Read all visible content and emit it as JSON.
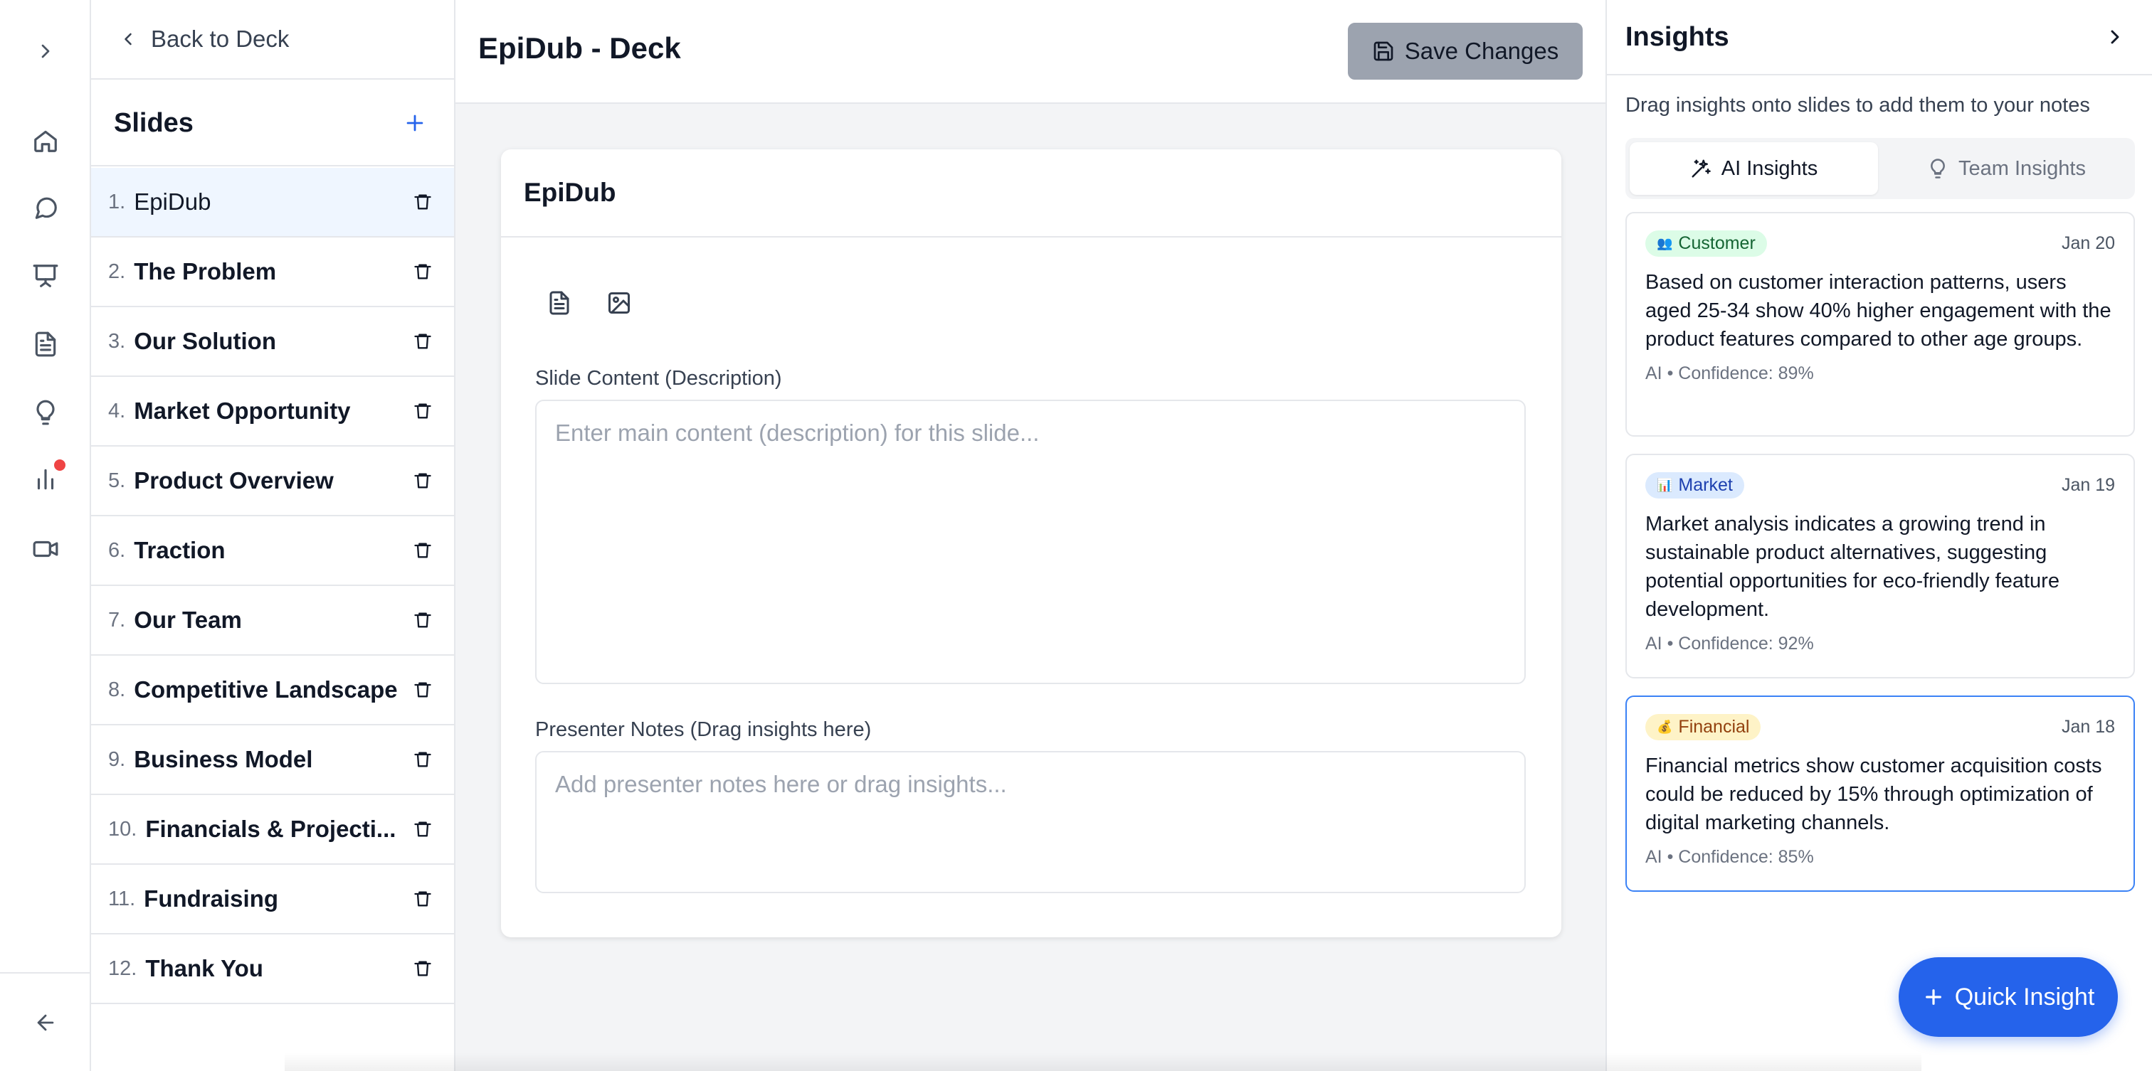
{
  "nav": {
    "items": [
      {
        "name": "expand",
        "icon": "chevron-right-icon"
      },
      {
        "name": "home",
        "icon": "home-icon"
      },
      {
        "name": "chat",
        "icon": "chat-icon"
      },
      {
        "name": "presentation",
        "icon": "presentation-icon"
      },
      {
        "name": "documents",
        "icon": "document-icon"
      },
      {
        "name": "ideas",
        "icon": "lightbulb-icon"
      },
      {
        "name": "analytics",
        "icon": "bar-chart-icon",
        "notification": true
      },
      {
        "name": "video",
        "icon": "video-icon"
      },
      {
        "name": "back",
        "icon": "arrow-left-icon"
      }
    ]
  },
  "sidebar": {
    "back_label": "Back to Deck",
    "title": "Slides",
    "slides": [
      {
        "num": "1.",
        "title": "EpiDub",
        "active": true
      },
      {
        "num": "2.",
        "title": "The Problem"
      },
      {
        "num": "3.",
        "title": "Our Solution"
      },
      {
        "num": "4.",
        "title": "Market Opportunity"
      },
      {
        "num": "5.",
        "title": "Product Overview"
      },
      {
        "num": "6.",
        "title": "Traction"
      },
      {
        "num": "7.",
        "title": "Our Team"
      },
      {
        "num": "8.",
        "title": "Competitive Landscape"
      },
      {
        "num": "9.",
        "title": "Business Model"
      },
      {
        "num": "10.",
        "title": "Financials & Projecti..."
      },
      {
        "num": "11.",
        "title": "Fundraising"
      },
      {
        "num": "12.",
        "title": "Thank You"
      }
    ]
  },
  "editor": {
    "deck_title": "EpiDub - Deck",
    "save_label": "Save Changes",
    "slide_title": "EpiDub",
    "content_label": "Slide Content (Description)",
    "content_placeholder": "Enter main content (description) for this slide...",
    "notes_label": "Presenter Notes (Drag insights here)",
    "notes_placeholder": "Add presenter notes here or drag insights..."
  },
  "insights": {
    "title": "Insights",
    "subtitle": "Drag insights onto slides to add them to your notes",
    "tabs": [
      {
        "label": "AI Insights",
        "active": true,
        "icon": "sparkles-icon"
      },
      {
        "label": "Team Insights",
        "active": false,
        "icon": "lightbulb-icon"
      }
    ],
    "cards": [
      {
        "category": "Customer",
        "emoji": "👥",
        "badge_bg": "#dcfce7",
        "badge_color": "#166534",
        "date": "Jan 20",
        "text": "Based on customer interaction patterns, users aged 25-34 show 40% higher engagement with the product features compared to other age groups.",
        "meta": "AI • Confidence: 89%",
        "selected": false
      },
      {
        "category": "Market",
        "emoji": "📊",
        "badge_bg": "#dbeafe",
        "badge_color": "#1e40af",
        "date": "Jan 19",
        "text": "Market analysis indicates a growing trend in sustainable product alternatives, suggesting potential opportunities for eco-friendly feature development.",
        "meta": "AI • Confidence: 92%",
        "selected": false
      },
      {
        "category": "Financial",
        "emoji": "💰",
        "badge_bg": "#fef3c7",
        "badge_color": "#92400e",
        "date": "Jan 18",
        "text": "Financial metrics show customer acquisition costs could be reduced by 15% through optimization of digital marketing channels.",
        "meta": "AI • Confidence: 85%",
        "selected": true
      }
    ],
    "quick_label": "Quick Insight"
  },
  "colors": {
    "accent": "#2563eb",
    "active_slide_bg": "#eff6ff",
    "notification": "#ef4444",
    "save_button_bg": "#9ca3af"
  }
}
